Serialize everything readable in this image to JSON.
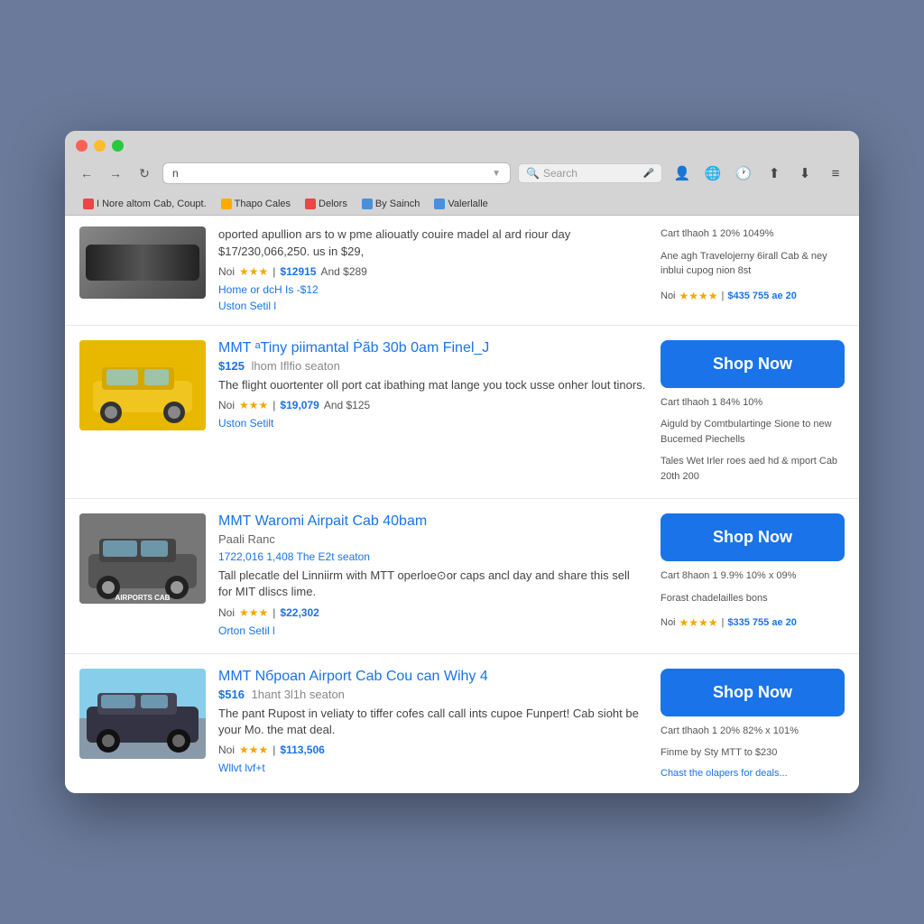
{
  "browser": {
    "url": "n",
    "search_placeholder": "Search",
    "bookmarks": [
      {
        "label": "I Nore altom Cab, Coupt.",
        "color": "#e44",
        "id": "bm1"
      },
      {
        "label": "Thapo Cales",
        "color": "#fa0",
        "id": "bm2"
      },
      {
        "label": "Delors",
        "color": "#e44",
        "id": "bm3"
      },
      {
        "label": "By Sainch",
        "color": "#4a90d9",
        "id": "bm4"
      },
      {
        "label": "Valerlalle",
        "color": "#4a90d9",
        "id": "bm5"
      }
    ]
  },
  "partial_top": {
    "desc": "oported apullion ars to w pme aliouatly couire madel al ard riour day $17/230,066,250. us in $29,",
    "rating_label": "Noi",
    "stars": 3,
    "price": "$12915",
    "and_price": "And $289",
    "link": "Home or dcH Is -$12",
    "link2": "Uston Setil l",
    "side_top": "Cart tlhaoh    1    20% 1049%",
    "side_text": "Ane agh Travelojerny 6irall Cab & ney inblui cupog nion 8st",
    "side_rating_label": "Noi",
    "side_stars": 4,
    "side_price": "$435 755 ae 20"
  },
  "items": [
    {
      "id": "item1",
      "title": "MMT ᵃTiny piimantal Ṗãb 30b 0am Finel_J",
      "price": "$125",
      "subtitle": "lhom Iflfio seaton",
      "desc": "The flight ouortenter oll port cat ibathing mat lange you tock usse onher lout tinors.",
      "rating_label": "Noi",
      "stars": 3,
      "price_now": "$19,079",
      "and_price": "And $125",
      "link": "Uston Setilt",
      "side_top": "Cart tlhaoh    1    84% 10%",
      "side_text": "Aiguld by Comtbulartinge Sione to new Bucemed Piechells",
      "side_text2": "Tales Wet Irler roes aed hd & mport Cab 20th 200",
      "has_button": true,
      "car_color": "yellow"
    },
    {
      "id": "item2",
      "title": "MMT Waromi Airpait Cab 40bam",
      "price": "",
      "subtitle": "Paali Ranc",
      "subtitle2": "1722,016 1,408  The E2t seaton",
      "desc": "Tall plecatle del Linniirm with MTT operloe⊙or caps ancl day and share this sell for MIT dliscs lime.",
      "rating_label": "Noi",
      "stars": 3,
      "price_now": "$22,302",
      "link": "Orton Setil l",
      "side_top": "Cart 8haon    1    9.9% 10% x 09%",
      "side_text": "Forast chadelailles bons",
      "side_rating_label": "Noi",
      "side_stars": 4,
      "side_price": "$335 755 ae 20",
      "has_button": true,
      "car_color": "airport",
      "img_label": "AIRPORTS CAB"
    },
    {
      "id": "item3",
      "title": "MMT Nброan Airport Cab Cou can Wihy 4",
      "price": "$516",
      "subtitle": "1hant 3l1h seaton",
      "desc": "The pant Rupost in veliaty to tiffer cofes call call ints cupoe Funpert! Cab sioht be your Mo. the mat deal.",
      "rating_label": "Noi",
      "stars": 3,
      "price_now": "$113,506",
      "link": "Wllvt lvf+t",
      "side_top": "Cart tlhaoh    1    20% 82% x 101%",
      "side_text": "Finme by Sty MTT to $230",
      "side_link": "Chast the olapers for deals...",
      "has_button": true,
      "car_color": "blue"
    }
  ],
  "labels": {
    "shop_now": "Shop Now"
  }
}
